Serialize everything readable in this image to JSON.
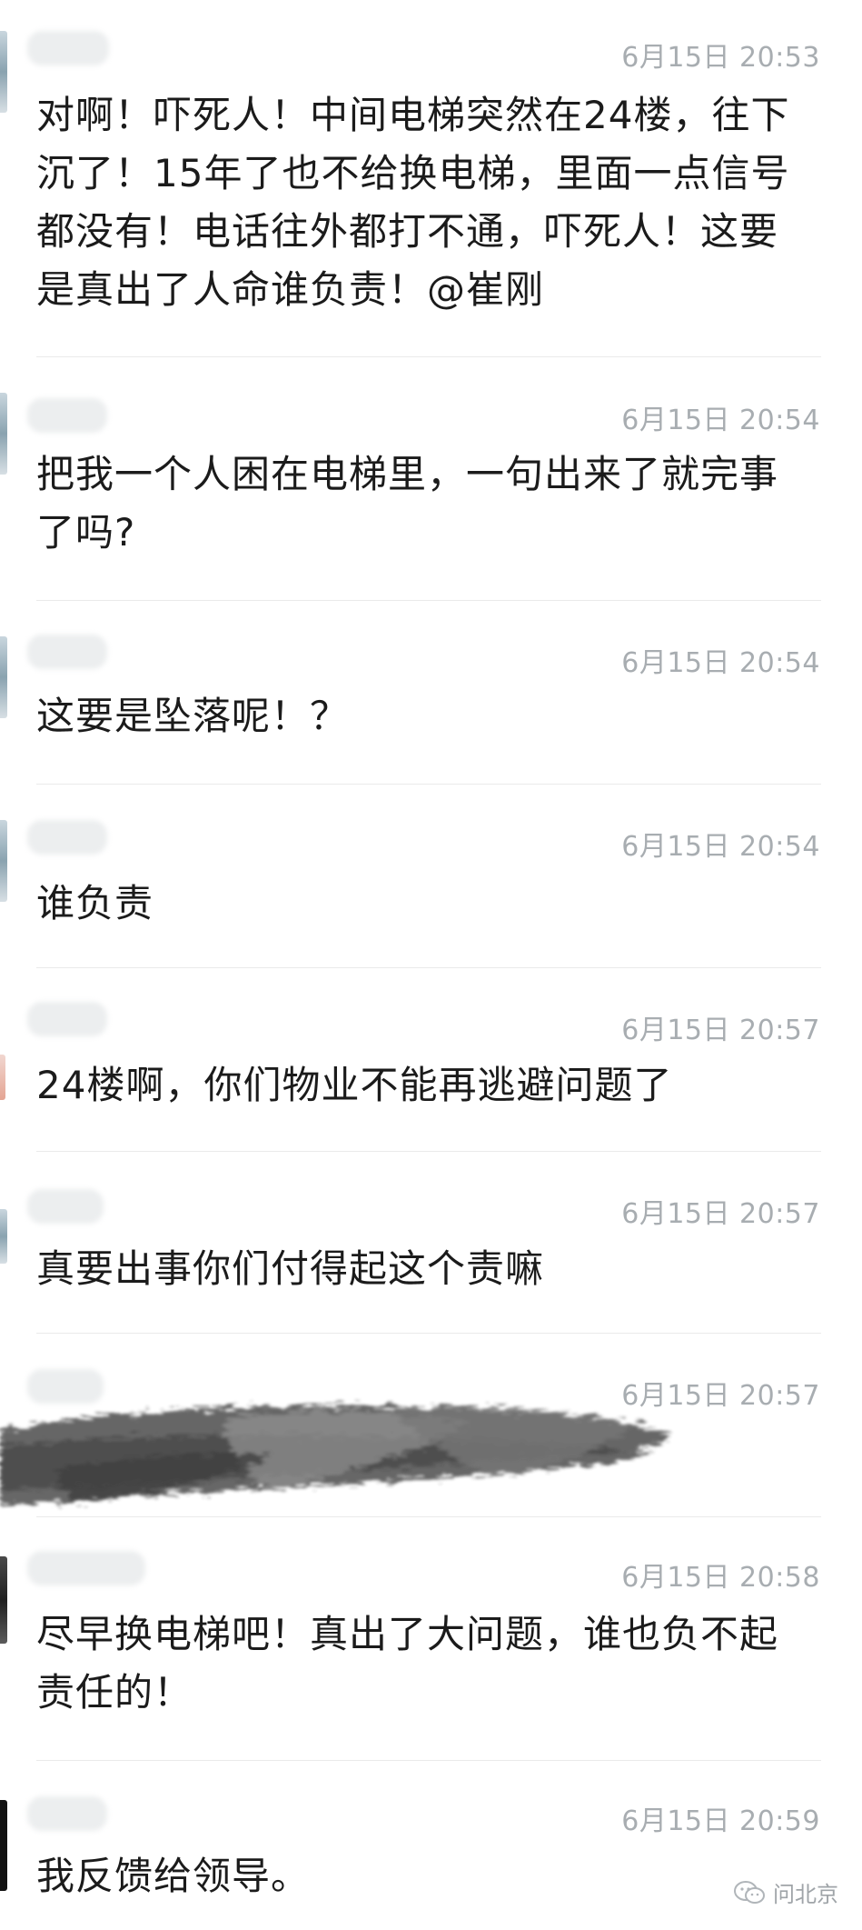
{
  "comments": [
    {
      "time": "6月15日 20:53",
      "text": "对啊！吓死人！中间电梯突然在24楼，往下沉了！15年了也不给换电梯，里面一点信号都没有！电话往外都打不通，吓死人！这要是真出了人命谁负责！@崔刚"
    },
    {
      "time": "6月15日 20:54",
      "text": "把我一个人困在电梯里，一句出来了就完事了吗?"
    },
    {
      "time": "6月15日 20:54",
      "text": "这要是坠落呢！？"
    },
    {
      "time": "6月15日 20:54",
      "text": "谁负责"
    },
    {
      "time": "6月15日 20:57",
      "text": "24楼啊，你们物业不能再逃避问题了"
    },
    {
      "time": "6月15日 20:57",
      "text": "真要出事你们付得起这个责嘛"
    },
    {
      "time": "6月15日 20:57",
      "text": ""
    },
    {
      "time": "6月15日 20:58",
      "text": "尽早换电梯吧！真出了大问题，谁也负不起责任的！"
    },
    {
      "time": "6月15日 20:59",
      "text": "我反馈给领导。"
    }
  ],
  "watermark": {
    "icon": "wechat-icon",
    "text": "问北京"
  }
}
